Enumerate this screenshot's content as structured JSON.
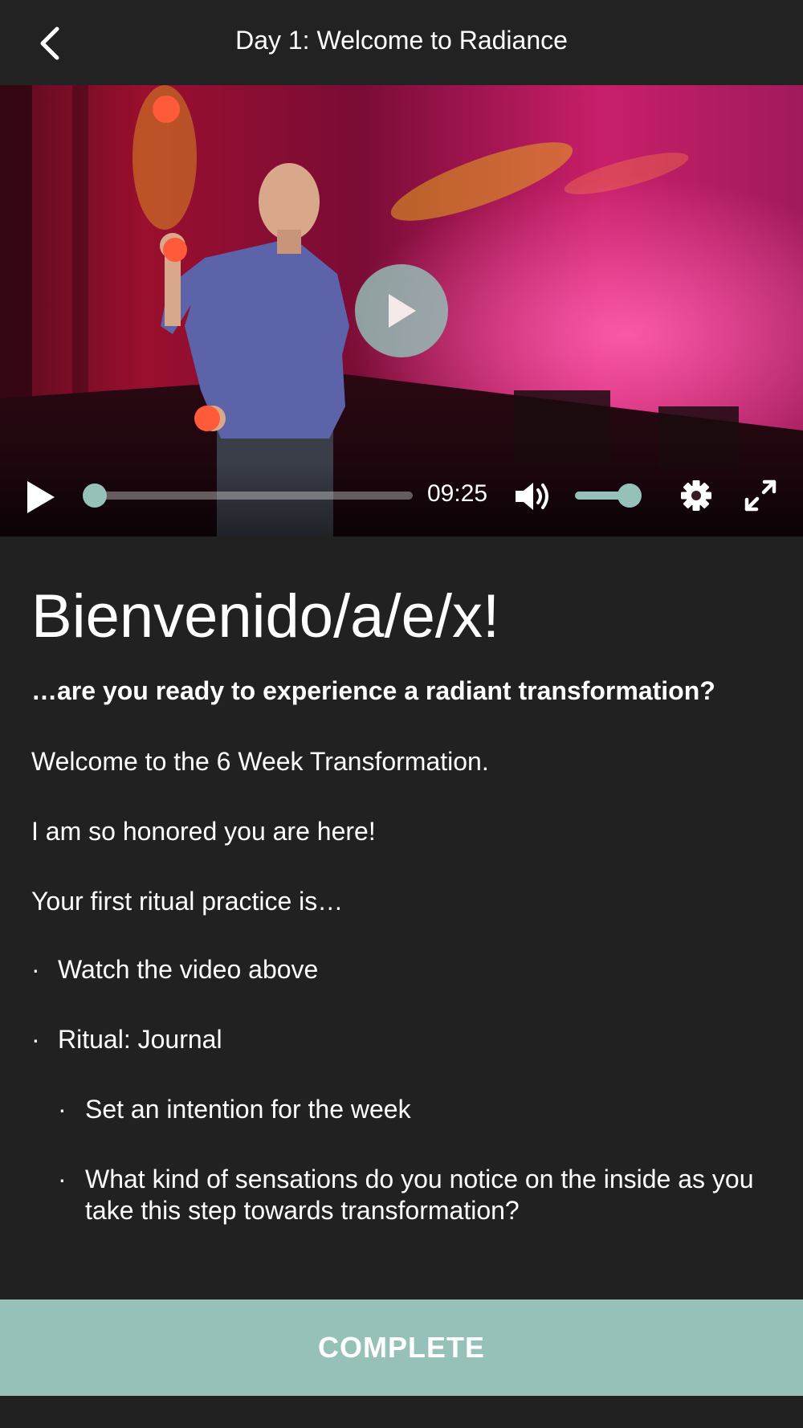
{
  "header": {
    "title": "Day 1: Welcome to Radiance"
  },
  "video": {
    "duration": "09:25",
    "progress_fraction": 0.0,
    "volume_fraction": 0.85,
    "accent_color": "#95c1b8"
  },
  "content": {
    "heading": "Bienvenido/a/e/x!",
    "subheading": "…are you ready to experience a radiant transformation?",
    "paragraphs": [
      "Welcome to the 6 Week Transformation.",
      "I am so honored you are here!",
      "Your first ritual practice is…"
    ],
    "bullets": [
      "Watch the video above",
      "Ritual: Journal"
    ],
    "sub_bullets": [
      "Set an intention for the week",
      "What kind of sensations do you notice on the inside as you take this step towards transformation?"
    ],
    "bullet_glyph": "·"
  },
  "footer": {
    "complete_label": "COMPLETE"
  }
}
